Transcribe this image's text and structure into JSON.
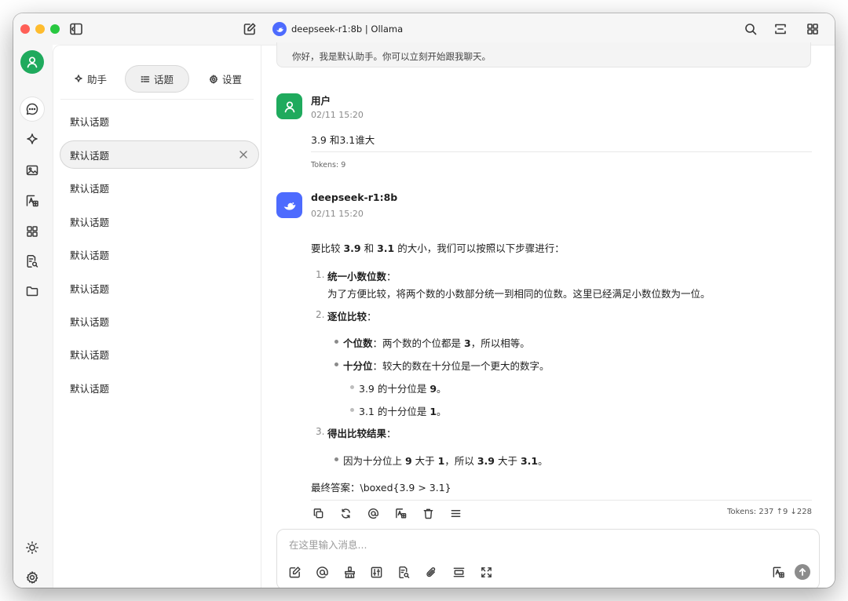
{
  "window": {
    "title": "deepseek-r1:8b | Ollama"
  },
  "colors": {
    "accent_green": "#1faa5d",
    "model_blue": "#4d6bfe",
    "traffic_close": "#ff5f57",
    "traffic_min": "#febc2e",
    "traffic_max": "#28c840"
  },
  "titlebar": {
    "icons": [
      "sidebar-toggle-icon",
      "new-chat-icon",
      "search-icon",
      "expand-icon",
      "grid-icon"
    ]
  },
  "rail": {
    "icons": [
      "user-avatar",
      "chat-icon",
      "sparkle-icon",
      "image-icon",
      "translate-icon",
      "apps-icon",
      "doc-search-icon",
      "folder-icon",
      "sun-icon",
      "gear-icon"
    ]
  },
  "panel": {
    "tabs": [
      {
        "label": "助手",
        "icon": "sparkle-icon"
      },
      {
        "label": "话题",
        "icon": "list-icon"
      },
      {
        "label": "设置",
        "icon": "gear-icon"
      }
    ],
    "topics": [
      {
        "label": "默认话题"
      },
      {
        "label": "默认话题"
      },
      {
        "label": "默认话题"
      },
      {
        "label": "默认话题"
      },
      {
        "label": "默认话题"
      },
      {
        "label": "默认话题"
      },
      {
        "label": "默认话题"
      },
      {
        "label": "默认话题"
      },
      {
        "label": "默认话题"
      }
    ],
    "active_topic_index": 1
  },
  "chat": {
    "welcome": "你好，我是默认助手。你可以立刻开始跟我聊天。",
    "user_msg": {
      "name": "用户",
      "time": "02/11 15:20",
      "text": "3.9 和3.1谁大",
      "tokens": "Tokens: 9"
    },
    "bot_msg": {
      "name": "deepseek-r1:8b",
      "time": "02/11 15:20",
      "tokens": "Tokens: 237 ↑9 ↓228",
      "answer": {
        "intro_a": "要比较 ",
        "intro_b": "3.9",
        "intro_c": " 和 ",
        "intro_d": "3.1",
        "intro_e": " 的大小，我们可以按照以下步骤进行：",
        "n1": "1.",
        "s1_title": "统一小数位数",
        "s1_colon": "：",
        "s1_body": "为了方便比较，将两个数的小数部分统一到相同的位数。这里已经满足小数位数为一位。",
        "n2": "2.",
        "s2_title": "逐位比较",
        "s2_colon": "：",
        "b1_title": "个位数",
        "b1_a": "：两个数的个位都是 ",
        "b1_b": "3",
        "b1_c": "，所以相等。",
        "b2_title": "十分位",
        "b2_a": "：较大的数在十分位是一个更大的数字。",
        "sb1_a": "3.9 的十分位是 ",
        "sb1_b": "9",
        "sb1_c": "。",
        "sb2_a": "3.1 的十分位是 ",
        "sb2_b": "1",
        "sb2_c": "。",
        "n3": "3.",
        "s3_title": "得出比较结果",
        "s3_colon": "：",
        "c_a": "因为十分位上 ",
        "c_b": "9",
        "c_c": " 大于 ",
        "c_d": "1",
        "c_e": "，所以 ",
        "c_f": "3.9",
        "c_g": " 大于 ",
        "c_h": "3.1",
        "c_i": "。",
        "final": "最终答案：\\boxed{3.9 > 3.1}"
      },
      "actions": [
        "copy-icon",
        "regenerate-icon",
        "mention-icon",
        "translate-icon",
        "delete-icon",
        "menu-icon"
      ]
    }
  },
  "composer": {
    "placeholder": "在这里输入消息...",
    "tools": [
      "edit-icon",
      "mention-icon",
      "clear-icon",
      "settings-sliders-icon",
      "doc-search-icon",
      "attach-icon",
      "expand-row-icon",
      "fullscreen-icon",
      "translate-icon",
      "send-icon"
    ]
  }
}
